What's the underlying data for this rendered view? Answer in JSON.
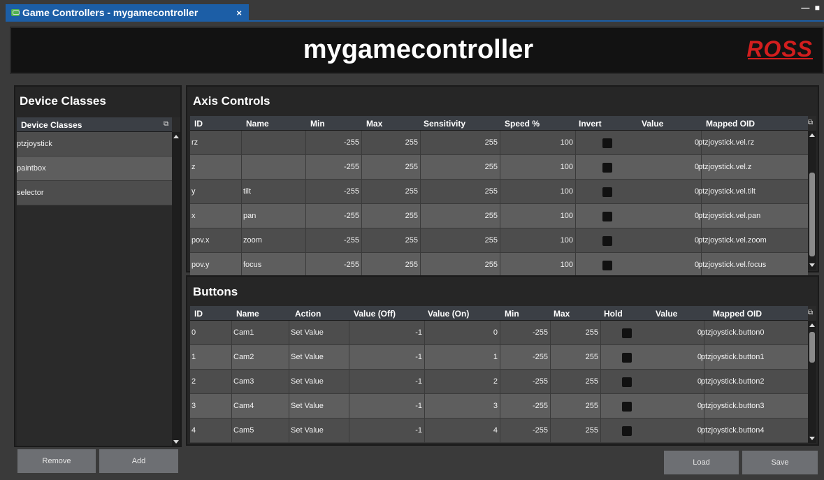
{
  "tab": {
    "title": "Game Controllers - mygamecontroller",
    "close": "×"
  },
  "window_controls": "— ■",
  "header": {
    "title": "mygamecontroller",
    "logo": "ROSS"
  },
  "device_classes": {
    "panel_title": "Device Classes",
    "column_header": "Device Classes",
    "items": [
      "ptzjoystick",
      "paintbox",
      "selector"
    ],
    "remove_label": "Remove",
    "add_label": "Add"
  },
  "axis_controls": {
    "panel_title": "Axis Controls",
    "columns": [
      "ID",
      "Name",
      "Min",
      "Max",
      "Sensitivity",
      "Speed %",
      "Invert",
      "Value",
      "Mapped OID"
    ],
    "rows": [
      {
        "id": "rz",
        "name": "",
        "min": "-255",
        "max": "255",
        "sensitivity": "255",
        "speed": "100",
        "value": "0",
        "oid": "ptzjoystick.vel.rz"
      },
      {
        "id": "z",
        "name": "",
        "min": "-255",
        "max": "255",
        "sensitivity": "255",
        "speed": "100",
        "value": "0",
        "oid": "ptzjoystick.vel.z"
      },
      {
        "id": "y",
        "name": "tilt",
        "min": "-255",
        "max": "255",
        "sensitivity": "255",
        "speed": "100",
        "value": "0",
        "oid": "ptzjoystick.vel.tilt"
      },
      {
        "id": "x",
        "name": "pan",
        "min": "-255",
        "max": "255",
        "sensitivity": "255",
        "speed": "100",
        "value": "0",
        "oid": "ptzjoystick.vel.pan"
      },
      {
        "id": "pov.x",
        "name": "zoom",
        "min": "-255",
        "max": "255",
        "sensitivity": "255",
        "speed": "100",
        "value": "0",
        "oid": "ptzjoystick.vel.zoom"
      },
      {
        "id": "pov.y",
        "name": "focus",
        "min": "-255",
        "max": "255",
        "sensitivity": "255",
        "speed": "100",
        "value": "0",
        "oid": "ptzjoystick.vel.focus"
      }
    ]
  },
  "buttons": {
    "panel_title": "Buttons",
    "columns": [
      "ID",
      "Name",
      "Action",
      "Value (Off)",
      "Value (On)",
      "Min",
      "Max",
      "Hold",
      "Value",
      "Mapped OID"
    ],
    "rows": [
      {
        "id": "0",
        "name": "Cam1",
        "action": "Set Value",
        "off": "-1",
        "on": "0",
        "min": "-255",
        "max": "255",
        "value": "0",
        "oid": "ptzjoystick.button0"
      },
      {
        "id": "1",
        "name": "Cam2",
        "action": "Set Value",
        "off": "-1",
        "on": "1",
        "min": "-255",
        "max": "255",
        "value": "0",
        "oid": "ptzjoystick.button1"
      },
      {
        "id": "2",
        "name": "Cam3",
        "action": "Set Value",
        "off": "-1",
        "on": "2",
        "min": "-255",
        "max": "255",
        "value": "0",
        "oid": "ptzjoystick.button2"
      },
      {
        "id": "3",
        "name": "Cam4",
        "action": "Set Value",
        "off": "-1",
        "on": "3",
        "min": "-255",
        "max": "255",
        "value": "0",
        "oid": "ptzjoystick.button3"
      },
      {
        "id": "4",
        "name": "Cam5",
        "action": "Set Value",
        "off": "-1",
        "on": "4",
        "min": "-255",
        "max": "255",
        "value": "0",
        "oid": "ptzjoystick.button4"
      }
    ]
  },
  "footer": {
    "load_label": "Load",
    "save_label": "Save"
  },
  "colors": {
    "tab_accent": "#1c5ea6",
    "logo": "#d21e1e",
    "row_dark": "#4d4d4d",
    "row_light": "#5e5e5e"
  },
  "icons": {
    "tab": "gamepad-icon",
    "column_menu": "column-chooser-icon"
  }
}
